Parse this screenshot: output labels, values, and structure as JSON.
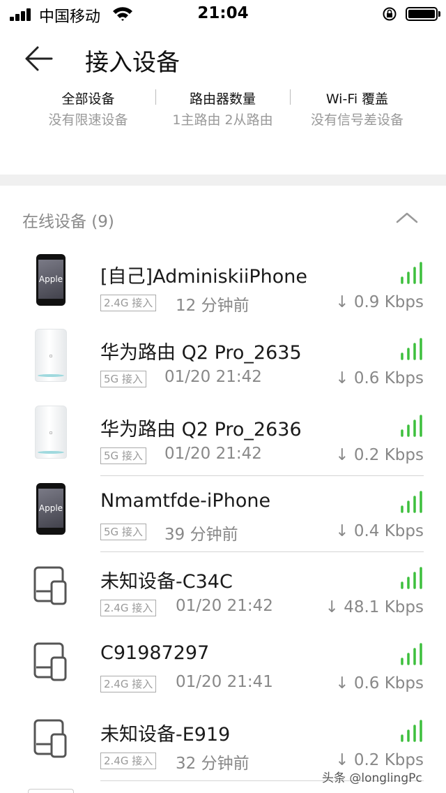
{
  "status_bar": {
    "carrier": "中国移动",
    "time": "21:04"
  },
  "header": {
    "title": "接入设备"
  },
  "summary": [
    {
      "title": "全部设备",
      "subtitle": "没有限速设备"
    },
    {
      "title": "路由器数量",
      "subtitle": "1主路由 2从路由"
    },
    {
      "title": "Wi-Fi 覆盖",
      "subtitle": "没有信号差设备"
    }
  ],
  "section": {
    "title": "在线设备 (9)"
  },
  "devices": [
    {
      "name": "[自己]AdminiskiiPhone",
      "icon": "apple-phone-icon",
      "icon_label": "Apple",
      "badge": "2.4G 接入",
      "time": "12 分钟前",
      "speed": "↓ 0.9 Kbps",
      "signal": 4
    },
    {
      "name": "华为路由 Q2 Pro_2635",
      "icon": "router-icon",
      "badge": "5G 接入",
      "time": "01/20 21:42",
      "speed": "↓ 0.6 Kbps",
      "signal": 4
    },
    {
      "name": "华为路由 Q2 Pro_2636",
      "icon": "router-icon",
      "badge": "5G 接入",
      "time": "01/20 21:42",
      "speed": "↓ 0.2 Kbps",
      "signal": 4
    },
    {
      "name": "Nmamtfde-iPhone",
      "icon": "apple-phone-icon",
      "icon_label": "Apple",
      "badge": "5G 接入",
      "time": "39 分钟前",
      "speed": "↓ 0.4 Kbps",
      "signal": 4
    },
    {
      "name": "未知设备-C34C",
      "icon": "unknown-device-icon",
      "badge": "2.4G 接入",
      "time": "01/20 21:42",
      "speed": "↓ 48.1 Kbps",
      "signal": 4
    },
    {
      "name": "C91987297",
      "icon": "unknown-device-icon",
      "badge": "2.4G 接入",
      "time": "01/20 21:41",
      "speed": "↓ 0.6 Kbps",
      "signal": 4
    },
    {
      "name": "未知设备-E919",
      "icon": "unknown-device-icon",
      "badge": "2.4G 接入",
      "time": "32 分钟前",
      "speed": "↓ 0.2 Kbps",
      "signal": 4
    }
  ],
  "watermark": "头条 @longlingPc",
  "colors": {
    "signal_green": "#3dbf3d",
    "band_gray": "#f0f0f0"
  }
}
